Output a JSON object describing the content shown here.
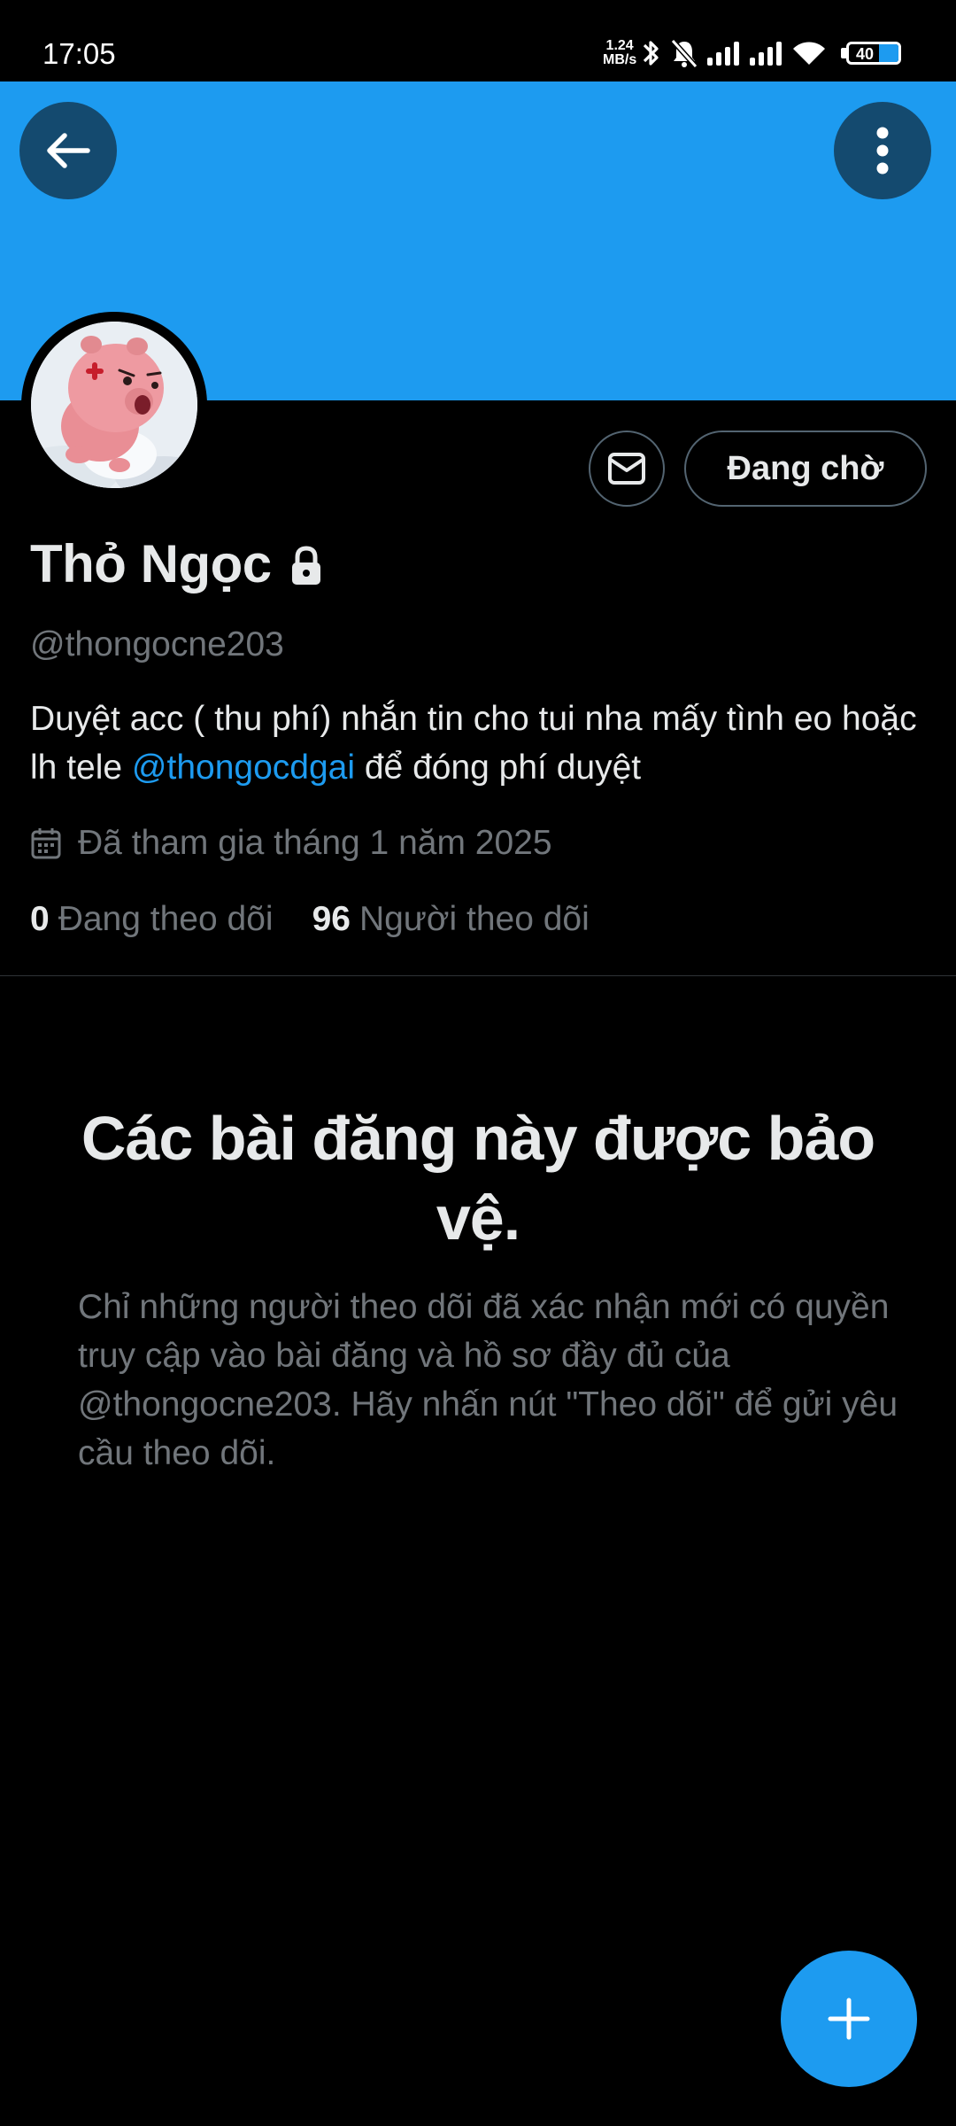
{
  "status_bar": {
    "time": "17:05",
    "net_speed_value": "1.24",
    "net_speed_unit": "MB/s",
    "battery": "40",
    "icons": [
      "bluetooth-icon",
      "bell-muted-icon",
      "signal-icon",
      "signal-icon",
      "wifi-icon",
      "battery-icon"
    ]
  },
  "colors": {
    "accent": "#1d9bf0",
    "background": "#000000",
    "primary_text": "#e7e9ea",
    "secondary_text": "#71767b",
    "border": "#536471"
  },
  "header": {
    "back_icon": "arrow-left-icon",
    "more_icon": "more-vertical-icon"
  },
  "profile": {
    "name": "Thỏ Ngọc",
    "handle": "@thongocne203",
    "bio_before": "Duyệt acc ( thu phí) nhắn tin cho tui nha mấy tình eo hoặc lh tele ",
    "bio_mention": "@thongocdgai",
    "bio_after": " để đóng phí duyệt",
    "joined": "Đã tham gia tháng 1 năm 2025",
    "following_count": "0",
    "following_label": "Đang theo dõi",
    "followers_count": "96",
    "followers_label": "Người theo dõi"
  },
  "actions": {
    "message_icon": "envelope-icon",
    "pending_label": "Đang chờ"
  },
  "protected": {
    "title": "Các bài đăng này được bảo vệ.",
    "description": "Chỉ những người theo dõi đã xác nhận mới có quyền truy cập vào bài đăng và hồ sơ đầy đủ của @thongocne203. Hãy nhấn nút \"Theo dõi\" để gửi yêu cầu theo dõi."
  },
  "fab": {
    "icon": "plus-icon"
  }
}
